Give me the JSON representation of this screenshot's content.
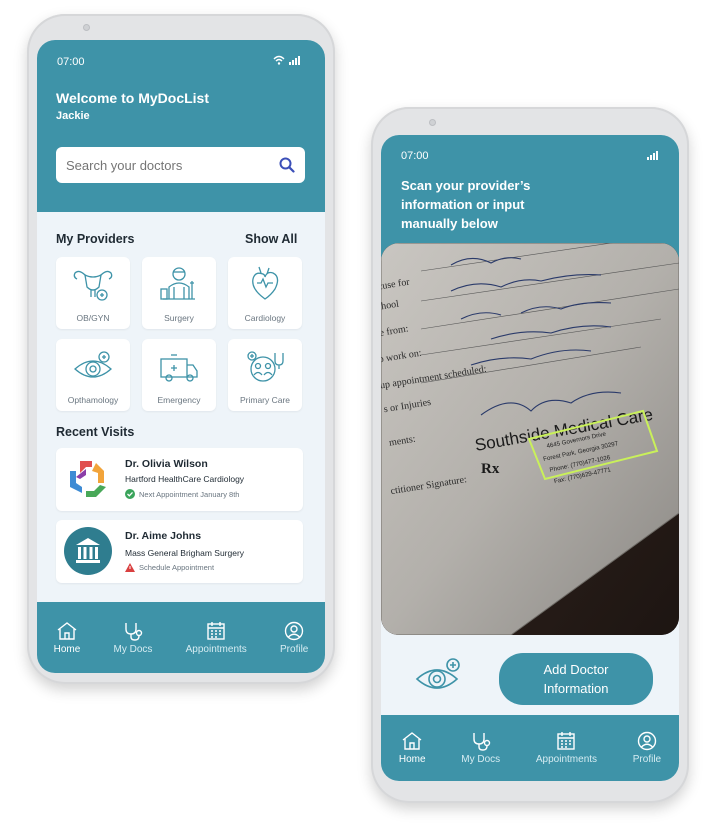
{
  "colors": {
    "accent": "#3e93a8",
    "background": "#eef4f9",
    "success": "#3aa45b",
    "warning": "#d94040"
  },
  "left_phone": {
    "time": "07:00",
    "welcome": "Welcome to MyDocList",
    "user_name": "Jackie",
    "search": {
      "placeholder": "Search your doctors"
    },
    "providers": {
      "title": "My Providers",
      "show_all": "Show All",
      "items": [
        {
          "label": "OB/GYN",
          "icon": "uterus-icon"
        },
        {
          "label": "Surgery",
          "icon": "surgeon-icon"
        },
        {
          "label": "Cardiology",
          "icon": "heart-icon"
        },
        {
          "label": "Opthamology",
          "icon": "eye-icon"
        },
        {
          "label": "Emergency",
          "icon": "ambulance-icon"
        },
        {
          "label": "Primary Care",
          "icon": "family-care-icon"
        }
      ]
    },
    "recent": {
      "title": "Recent Visits",
      "items": [
        {
          "name": "Dr. Olivia Wilson",
          "org": "Hartford HealthCare Cardiology",
          "status": "Next Appointment January 8th",
          "status_type": "ok"
        },
        {
          "name": "Dr. Aime Johns",
          "org": "Mass General Brigham Surgery",
          "status": "Schedule Appointment",
          "status_type": "warn"
        }
      ]
    }
  },
  "right_phone": {
    "time": "07:00",
    "instruction": [
      "Scan your provider’s",
      "information or input",
      "manually below"
    ],
    "add_button": [
      "Add Doctor",
      "Information"
    ],
    "document": {
      "lines": [
        "excuse for",
        "/ school",
        "are from:",
        "to work on:",
        "up appointment scheduled:",
        "s or Injuries",
        "ments:",
        "ctitioner Signature:"
      ],
      "clinic": "Southside Medical Care",
      "rx": "Rx",
      "address": [
        "4645 Governors Drive",
        "Forest Park, Georgia 30297",
        "Phone: (770)477-1026",
        "Fax: (770)629-47771"
      ]
    }
  },
  "nav": [
    {
      "label": "Home",
      "icon": "home-icon"
    },
    {
      "label": "My Docs",
      "icon": "stethoscope-icon"
    },
    {
      "label": "Appointments",
      "icon": "calendar-icon"
    },
    {
      "label": "Profile",
      "icon": "profile-icon"
    }
  ]
}
